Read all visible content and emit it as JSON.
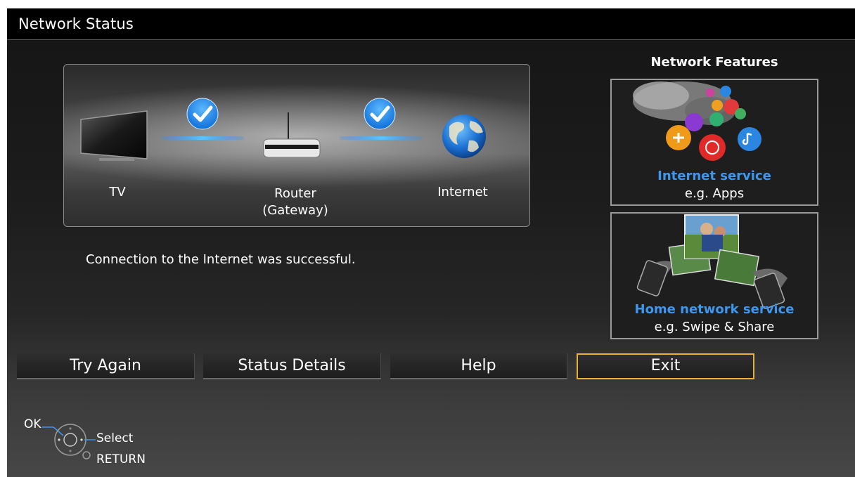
{
  "header": {
    "title": "Network Status"
  },
  "diagram": {
    "nodes": [
      {
        "label": "TV",
        "sub": ""
      },
      {
        "label": "Router",
        "sub": "(Gateway)"
      },
      {
        "label": "Internet",
        "sub": ""
      }
    ],
    "links": [
      {
        "status": "ok"
      },
      {
        "status": "ok"
      }
    ]
  },
  "status_message": "Connection to the Internet was successful.",
  "features": {
    "title": "Network Features",
    "items": [
      {
        "name": "Internet service",
        "example": "e.g. Apps"
      },
      {
        "name": "Home network service",
        "example": "e.g. Swipe & Share"
      }
    ]
  },
  "buttons": [
    {
      "label": "Try Again",
      "focused": false
    },
    {
      "label": "Status Details",
      "focused": false
    },
    {
      "label": "Help",
      "focused": false
    },
    {
      "label": "Exit",
      "focused": true
    }
  ],
  "hints": {
    "ok": "OK",
    "select": "Select",
    "return": "RETURN"
  },
  "colors": {
    "accent_blue": "#3e97ee",
    "focus_border": "#e8b23a",
    "check": "#1d8fe8"
  }
}
